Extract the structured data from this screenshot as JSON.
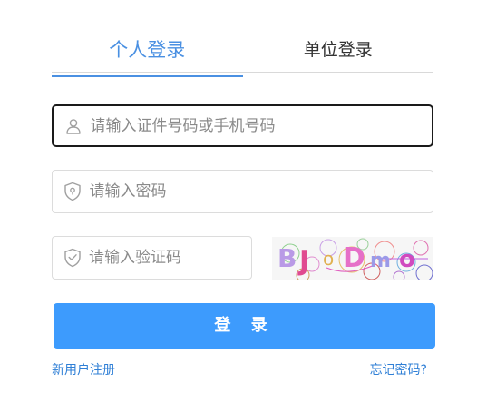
{
  "tabs": [
    {
      "label": "个人登录",
      "active": true
    },
    {
      "label": "单位登录",
      "active": false
    }
  ],
  "form": {
    "id_placeholder": "请输入证件号码或手机号码",
    "password_placeholder": "请输入密码",
    "captcha_placeholder": "请输入验证码",
    "captcha_text": "BJDmo",
    "submit_label": "登 录"
  },
  "links": {
    "register": "新用户注册",
    "forgot": "忘记密码?"
  },
  "icons": {
    "id": "user-icon",
    "password": "shield-lock-icon",
    "captcha": "shield-check-icon"
  },
  "colors": {
    "accent": "#4a90e2",
    "button": "#3d9bfd",
    "link": "#2f7fd6"
  }
}
